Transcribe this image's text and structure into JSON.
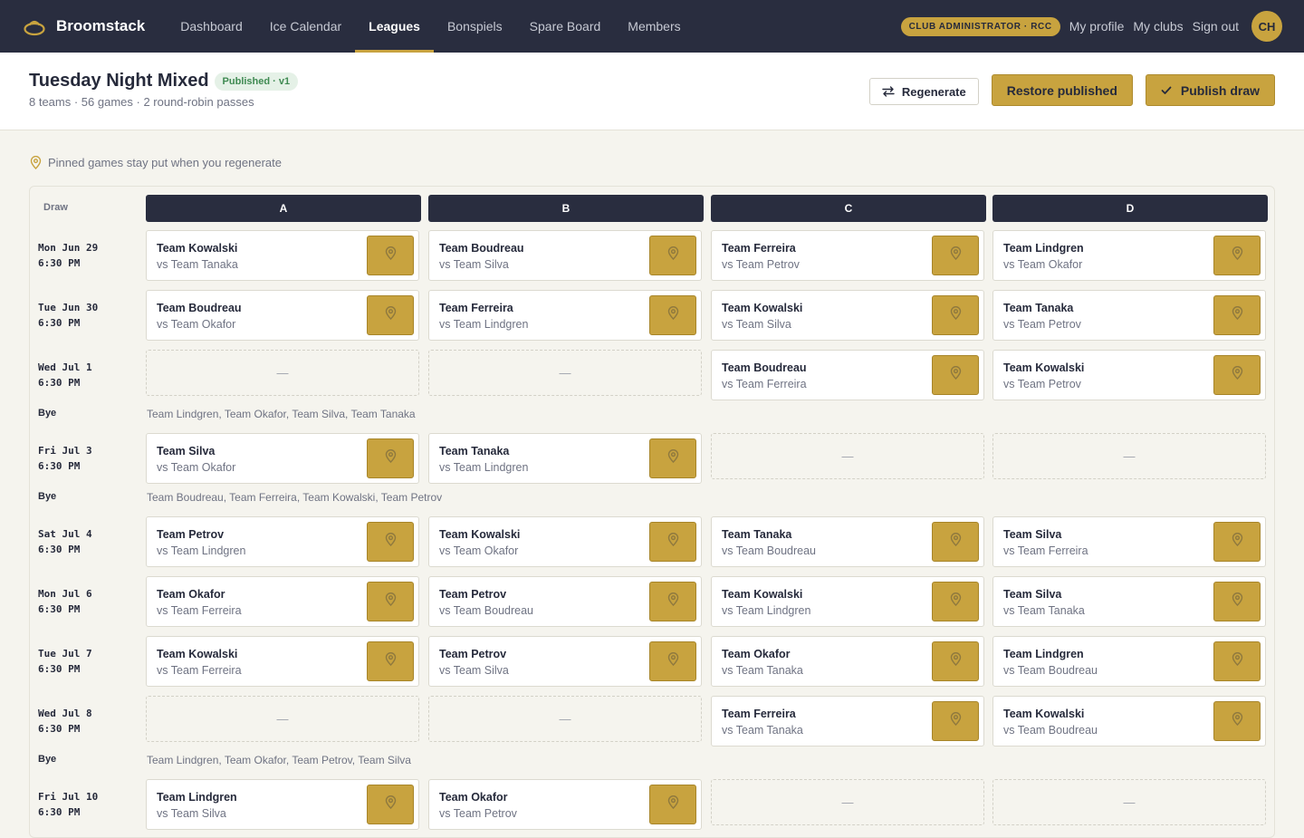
{
  "app": {
    "name": "Broomstack",
    "nav": [
      "Dashboard",
      "Ice Calendar",
      "Leagues",
      "Bonspiels",
      "Spare Board",
      "Members"
    ],
    "active_nav": "Leagues",
    "role_badge": "CLUB ADMINISTRATOR · RCC",
    "links": [
      "My profile",
      "My clubs",
      "Sign out"
    ],
    "avatar_initials": "CH"
  },
  "page": {
    "title": "Tuesday Night Mixed",
    "status_badge": "Published · v1",
    "subtitle": "8 teams · 56 games · 2 round-robin passes",
    "actions": {
      "regenerate": "Regenerate",
      "restore": "Restore published",
      "publish": "Publish draw"
    }
  },
  "hint": "Pinned games stay put when you regenerate",
  "grid": {
    "draw_header": "Draw",
    "sheets": [
      "A",
      "B",
      "C",
      "D"
    ],
    "empty_mark": "—",
    "rows": [
      {
        "kind": "draw",
        "date": "Mon Jun 29",
        "time": "6:30 PM",
        "games": [
          {
            "home": "Team Kowalski",
            "away": "vs Team Tanaka"
          },
          {
            "home": "Team Boudreau",
            "away": "vs Team Silva"
          },
          {
            "home": "Team Ferreira",
            "away": "vs Team Petrov"
          },
          {
            "home": "Team Lindgren",
            "away": "vs Team Okafor"
          }
        ]
      },
      {
        "kind": "draw",
        "date": "Tue Jun 30",
        "time": "6:30 PM",
        "games": [
          {
            "home": "Team Boudreau",
            "away": "vs Team Okafor"
          },
          {
            "home": "Team Ferreira",
            "away": "vs Team Lindgren"
          },
          {
            "home": "Team Kowalski",
            "away": "vs Team Silva"
          },
          {
            "home": "Team Tanaka",
            "away": "vs Team Petrov"
          }
        ]
      },
      {
        "kind": "draw",
        "date": "Wed Jul 1",
        "time": "6:30 PM",
        "games": [
          null,
          null,
          {
            "home": "Team Boudreau",
            "away": "vs Team Ferreira"
          },
          {
            "home": "Team Kowalski",
            "away": "vs Team Petrov"
          }
        ]
      },
      {
        "kind": "bye",
        "label": "Bye",
        "teams": "Team Lindgren, Team Okafor, Team Silva, Team Tanaka"
      },
      {
        "kind": "draw",
        "date": "Fri Jul 3",
        "time": "6:30 PM",
        "games": [
          {
            "home": "Team Silva",
            "away": "vs Team Okafor"
          },
          {
            "home": "Team Tanaka",
            "away": "vs Team Lindgren"
          },
          null,
          null
        ]
      },
      {
        "kind": "bye",
        "label": "Bye",
        "teams": "Team Boudreau, Team Ferreira, Team Kowalski, Team Petrov"
      },
      {
        "kind": "draw",
        "date": "Sat Jul 4",
        "time": "6:30 PM",
        "games": [
          {
            "home": "Team Petrov",
            "away": "vs Team Lindgren"
          },
          {
            "home": "Team Kowalski",
            "away": "vs Team Okafor"
          },
          {
            "home": "Team Tanaka",
            "away": "vs Team Boudreau"
          },
          {
            "home": "Team Silva",
            "away": "vs Team Ferreira"
          }
        ]
      },
      {
        "kind": "draw",
        "date": "Mon Jul 6",
        "time": "6:30 PM",
        "games": [
          {
            "home": "Team Okafor",
            "away": "vs Team Ferreira"
          },
          {
            "home": "Team Petrov",
            "away": "vs Team Boudreau"
          },
          {
            "home": "Team Kowalski",
            "away": "vs Team Lindgren"
          },
          {
            "home": "Team Silva",
            "away": "vs Team Tanaka"
          }
        ]
      },
      {
        "kind": "draw",
        "date": "Tue Jul 7",
        "time": "6:30 PM",
        "games": [
          {
            "home": "Team Kowalski",
            "away": "vs Team Ferreira"
          },
          {
            "home": "Team Petrov",
            "away": "vs Team Silva"
          },
          {
            "home": "Team Okafor",
            "away": "vs Team Tanaka"
          },
          {
            "home": "Team Lindgren",
            "away": "vs Team Boudreau"
          }
        ]
      },
      {
        "kind": "draw",
        "date": "Wed Jul 8",
        "time": "6:30 PM",
        "games": [
          null,
          null,
          {
            "home": "Team Ferreira",
            "away": "vs Team Tanaka"
          },
          {
            "home": "Team Kowalski",
            "away": "vs Team Boudreau"
          }
        ]
      },
      {
        "kind": "bye",
        "label": "Bye",
        "teams": "Team Lindgren, Team Okafor, Team Petrov, Team Silva"
      },
      {
        "kind": "draw",
        "date": "Fri Jul 10",
        "time": "6:30 PM",
        "games": [
          {
            "home": "Team Lindgren",
            "away": "vs Team Silva"
          },
          {
            "home": "Team Okafor",
            "away": "vs Team Petrov"
          },
          null,
          null
        ]
      }
    ]
  },
  "colors": {
    "nav_bg": "#292d3f",
    "accent_gold": "#c8a33f",
    "published_green": "#3f8a52",
    "page_bg": "#f5f4ee"
  }
}
